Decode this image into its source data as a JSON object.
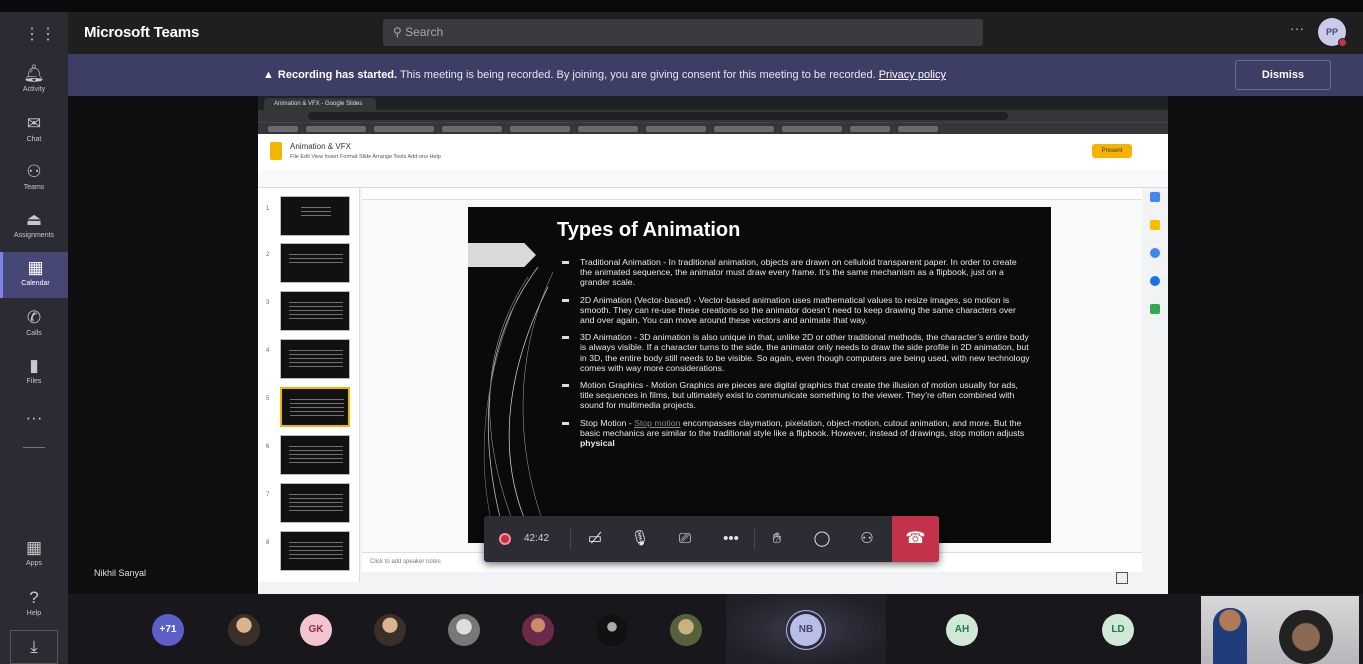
{
  "app": {
    "title": "Microsoft Teams"
  },
  "search": {
    "placeholder": "Search",
    "icon": "search-icon"
  },
  "top_right": {
    "more": "···",
    "avatar_initials": "PP"
  },
  "rail": [
    {
      "label": "Activity",
      "icon": "bell-icon"
    },
    {
      "label": "Chat",
      "icon": "chat-icon"
    },
    {
      "label": "Teams",
      "icon": "teams-icon"
    },
    {
      "label": "Assignments",
      "icon": "assignments-icon"
    },
    {
      "label": "Calendar",
      "icon": "calendar-icon",
      "active": true
    },
    {
      "label": "Calls",
      "icon": "phone-icon"
    },
    {
      "label": "Files",
      "icon": "file-icon"
    },
    {
      "label": "···",
      "icon": "more-icon"
    },
    {
      "label": "Apps",
      "icon": "apps-icon"
    },
    {
      "label": "Help",
      "icon": "help-icon"
    },
    {
      "label": "",
      "icon": "download-icon"
    }
  ],
  "banner": {
    "warning_icon": "▲",
    "bold": "Recording has started.",
    "text": " This meeting is being recorded. By joining, you are giving consent for this meeting to be recorded. ",
    "link": "Privacy policy",
    "dismiss": "Dismiss"
  },
  "presenter": {
    "name": "Nikhil Sanyal"
  },
  "slides_app": {
    "tab_title": "Animation & VFX - Google Slides",
    "doc_title": "Animation & VFX",
    "menu": "File  Edit  View  Insert  Format  Slide  Arrange  Tools  Add-ons  Help",
    "present_label": "Present",
    "notes_placeholder": "Click to add speaker notes"
  },
  "slide": {
    "title": "Types of Animation",
    "bullets": [
      "Traditional Animation -  In traditional animation, objects are drawn on celluloid transparent paper. In order to create the animated sequence, the animator must draw every frame. It’s the same mechanism as a flipbook, just on a grander scale.",
      "2D Animation (Vector-based) - Vector-based animation uses mathematical values to resize images, so motion is smooth. They can re-use these creations so the animator doesn’t need to keep drawing the same characters over and over again. You can move around these vectors and animate that way.",
      "3D Animation - 3D animation is also unique in that, unlike 2D or other traditional methods, the character’s entire body is always visible. If a character turns to the side, the animator only needs to draw the side profile in 2D animation, but in 3D, the entire body still needs to be visible. So again, even though computers are being used, with new technology comes with way more considerations.",
      "Motion Graphics - Motion Graphics are pieces are digital graphics that create the illusion of motion usually for ads, title sequences in films, but ultimately exist to communicate something to the viewer. They’re often combined with sound for multimedia projects."
    ],
    "last_bullet_prefix": "Stop Motion - ",
    "last_bullet_link": "Stop motion",
    "last_bullet_rest": " encompasses claymation, pixelation, object-motion, cutout animation, and more. But the basic mechanics are similar to the traditional style like a flipbook. However, instead of drawings, stop motion adjusts ",
    "last_bullet_bold": "physical"
  },
  "call": {
    "timer": "42:42",
    "controls": [
      "camera-off-icon",
      "mic-off-icon",
      "share-screen-icon",
      "more-actions-icon",
      "raise-hand-icon",
      "chat-icon",
      "participants-icon"
    ],
    "hangup_icon": "hang-up-icon"
  },
  "participants": [
    {
      "initials": "+71",
      "color": "#5b5fc7"
    },
    {
      "initials": "",
      "photo": true
    },
    {
      "initials": "GK",
      "color": "#f3c3d0"
    },
    {
      "initials": "",
      "photo": true
    },
    {
      "initials": "",
      "photo": true
    },
    {
      "initials": "",
      "photo": true
    },
    {
      "initials": "",
      "photo": true
    },
    {
      "initials": "",
      "photo": true
    },
    {
      "initials": "NB",
      "color": "#b9bde8"
    },
    {
      "initials": "AH",
      "color": "#cfe9d6"
    },
    {
      "initials": "LD",
      "color": "#cfe9d6"
    }
  ]
}
